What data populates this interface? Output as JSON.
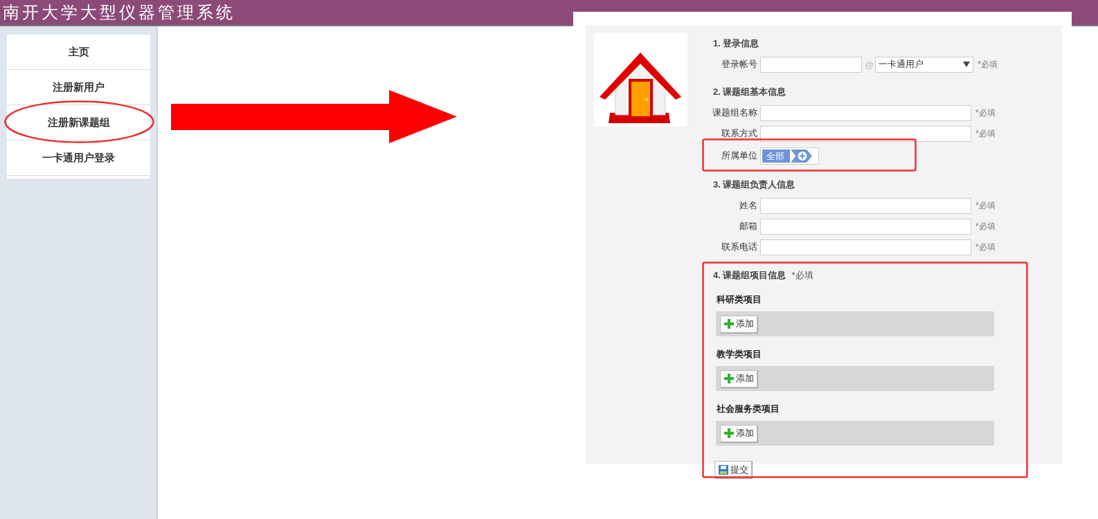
{
  "header": {
    "title": "南开大学大型仪器管理系统"
  },
  "sidebar": {
    "items": [
      {
        "label": "主页"
      },
      {
        "label": "注册新用户"
      },
      {
        "label": "注册新课题组"
      },
      {
        "label": "一卡通用户登录"
      }
    ]
  },
  "form": {
    "sections": [
      {
        "heading": "1. 登录信息",
        "fields": [
          {
            "kind": "account",
            "label": "登录帐号",
            "at": "@",
            "select_value": "一卡通用户",
            "required": "*必填"
          }
        ]
      },
      {
        "heading": "2. 课题组基本信息",
        "fields": [
          {
            "kind": "text",
            "label": "课题组名称",
            "required": "*必填"
          },
          {
            "kind": "text",
            "label": "联系方式",
            "required": "*必填"
          },
          {
            "kind": "unit",
            "label": "所属单位",
            "chip": "全部"
          }
        ]
      },
      {
        "heading": "3. 课题组负责人信息",
        "fields": [
          {
            "kind": "text",
            "label": "姓名",
            "required": "*必填"
          },
          {
            "kind": "text",
            "label": "邮箱",
            "required": "*必填"
          },
          {
            "kind": "text",
            "label": "联系电话",
            "required": "*必填"
          }
        ]
      }
    ],
    "projects": {
      "heading": "4. 课题组项目信息",
      "required": "*必填",
      "groups": [
        {
          "title": "科研类项目",
          "add_button": "添加"
        },
        {
          "title": "教学类项目",
          "add_button": "添加"
        },
        {
          "title": "社会服务类项目",
          "add_button": "添加"
        }
      ]
    },
    "submit_button": "提交"
  }
}
